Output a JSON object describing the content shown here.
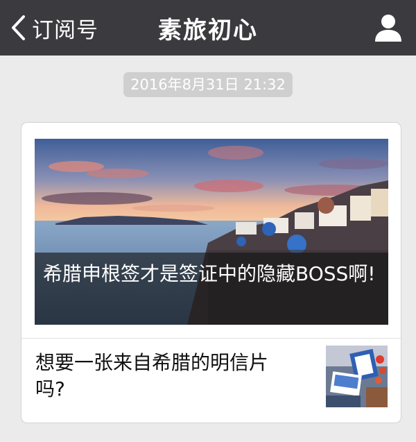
{
  "navbar": {
    "back_label": "订阅号",
    "title": "素旅初心"
  },
  "message": {
    "timestamp": "2016年8月31日 21:32"
  },
  "article": {
    "cover_title": "希腊申根签才是签证中的隐藏BOSS啊!",
    "sub_title": "想要一张来自希腊的明信片吗?"
  },
  "colors": {
    "navbar_bg": "#3a3a3f",
    "page_bg": "#ebebeb",
    "card_bg": "#ffffff"
  },
  "icons": {
    "back": "chevron-left-icon",
    "profile": "person-icon"
  }
}
